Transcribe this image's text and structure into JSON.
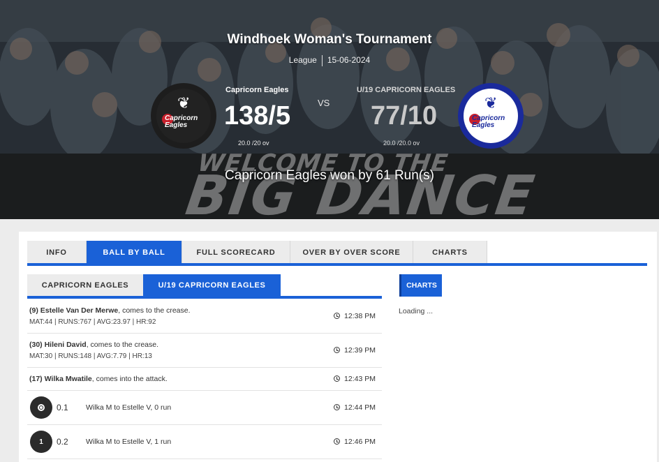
{
  "match": {
    "title": "Windhoek Woman's Tournament",
    "stage": "League",
    "date": "15-06-2024",
    "vs_label": "VS",
    "result": "Capricorn Eagles won by 61 Run(s)"
  },
  "team_a": {
    "name": "Capricorn Eagles",
    "score": "138/5",
    "overs": "20.0 /20 ov",
    "logo_text": "Capricorn Eagles"
  },
  "team_b": {
    "name": "U/19 CAPRICORN EAGLES",
    "score": "77/10",
    "overs": "20.0 /20.0 ov",
    "logo_text": "Capricorn Eagles"
  },
  "banner": {
    "line1": "WELCOME TO THE",
    "line2": "BIG DANCE"
  },
  "tabs": [
    {
      "label": "INFO",
      "active": false
    },
    {
      "label": "BALL BY BALL",
      "active": true
    },
    {
      "label": "FULL SCORECARD",
      "active": false
    },
    {
      "label": "OVER BY OVER SCORE",
      "active": false
    },
    {
      "label": "CHARTS",
      "active": false
    }
  ],
  "subtabs": [
    {
      "label": "CAPRICORN EAGLES",
      "active": false
    },
    {
      "label": "U/19 CAPRICORN EAGLES",
      "active": true
    }
  ],
  "feed": [
    {
      "kind": "event",
      "player": "(9) Estelle Van Der Merwe",
      "action": ", comes to the crease.",
      "stats": "MAT:44 | RUNS:767 | AVG:23.97 | HR:92",
      "time": "12:38 PM"
    },
    {
      "kind": "event",
      "player": "(30) Hileni David",
      "action": ", comes to the crease.",
      "stats": "MAT:30 | RUNS:148 | AVG:7.79 | HR:13",
      "time": "12:39 PM"
    },
    {
      "kind": "event",
      "player": "(17) Wilka Mwatile",
      "action": ", comes into the attack.",
      "stats": "",
      "time": "12:43 PM"
    },
    {
      "kind": "ball",
      "badge": "dot",
      "over": "0.1",
      "desc": "Wilka M to Estelle V, 0 run",
      "time": "12:44 PM"
    },
    {
      "kind": "ball",
      "badge": "1",
      "over": "0.2",
      "desc": "Wilka M to Estelle V, 1 run",
      "time": "12:46 PM"
    }
  ],
  "charts_panel": {
    "heading": "CHARTS",
    "status": "Loading ..."
  },
  "colors": {
    "accent": "#1a61d7",
    "dark": "#2b2b2b"
  }
}
